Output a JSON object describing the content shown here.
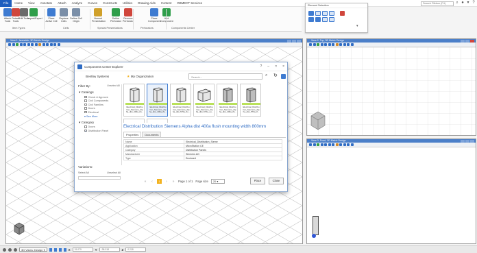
{
  "menu": {
    "file": "File",
    "items": [
      "Home",
      "View",
      "Annotate",
      "Attach",
      "Analyze",
      "Curves",
      "Constructs",
      "Utilities",
      "Drawing Aids",
      "Content",
      "OBMECT Services"
    ],
    "search_placeholder": "Search Ribbon (F4)"
  },
  "ribbon": {
    "buttons": [
      {
        "label": "Attach Tools",
        "color": "#3e7bd1"
      },
      {
        "label": "Detach Tools",
        "color": "#d0463c"
      },
      {
        "label": "Edit Tools",
        "color": "#6a6a6a"
      },
      {
        "label": "Import/Export",
        "color": "#2f9e4a"
      },
      {
        "label": "Place Active Cell",
        "color": "#3e7bd1"
      },
      {
        "label": "Replace Cells",
        "color": "#7b8fa8"
      },
      {
        "label": "Define Cell Origin",
        "color": "#7b8fa8"
      },
      {
        "label": "Normal Presentation",
        "color": "#d0a02a"
      },
      {
        "label": "Define Perforator",
        "color": "#2f9e4a"
      },
      {
        "label": "Remove Perforator",
        "color": "#d0463c"
      },
      {
        "label": "Place Component",
        "color": "#3e7bd1"
      },
      {
        "label": "Add Component",
        "color": "#2f9e4a"
      }
    ],
    "groups": [
      "Item Types",
      "Cells",
      "Special Presentations",
      "Perforators",
      "Components Center"
    ]
  },
  "element_selection": {
    "title": "Element Selection"
  },
  "views": {
    "view1_title": "View 1, Isometric, 3D Metric Design",
    "view2_title": "View 2, Top, 3D Metric Design",
    "view3_title": "View 3, Front, 3D Metric Design"
  },
  "dialog": {
    "title": "Components Center Explorer",
    "org": "Bentley Systems",
    "scope": "My Organization",
    "search_placeholder": "Search...",
    "filter_by": "Filter By:",
    "clear_all": "Unselect All",
    "catalogs_header": "Catalogs",
    "catalogs": [
      "Check & Approve",
      "Civil Components",
      "Civil Families",
      "Doors",
      "Electrical"
    ],
    "see_more": "See More",
    "category_header": "Category",
    "categories": [
      "Doors",
      "Distribution Panel"
    ],
    "variations_header": "Variations:",
    "select_all": "Select All",
    "unselect_all": "Unselect All",
    "thumbnails": [
      "Electrical_Distribu tion_Siemens_Alp ha_dist_400a_flu...",
      "Electrical_Distribu tion_Siemens_Alp ha_dist_400a_flu...",
      "Electrical_Distribu tion_Siemens_Alp ha_dist_570a_flu...",
      "Electrical_Distribu tion_Siemens_Alp ha_dist_570a_su...",
      "Electrical_Distribu tion_Siemens_Alp ha_dist_400a_flu...",
      "Electrical_Distribu tion_Siemens_Alp ha_dist_570a_fl..."
    ],
    "detail_title": "Electrical Distribution Siemens Alpha dist 400a flush mounting width 800mm",
    "tabs": [
      "Properties",
      "Documents"
    ],
    "properties": [
      [
        "Name",
        "Electrical_Distribution_Sieme"
      ],
      [
        "Application",
        "MicroStation CE"
      ],
      [
        "Category",
        "Distribution Panels"
      ],
      [
        "Manufacturer",
        "Siemens AG"
      ],
      [
        "Type",
        "Enclosed"
      ]
    ],
    "page": "1",
    "page_text": "Page 1 of 1",
    "page_size_label": "Page size",
    "page_size": "20",
    "place_label": "Place",
    "close_label": "Close"
  },
  "statusbar": {
    "view_select": "3D Views: Design",
    "x_label": "X",
    "x_value": "31.079",
    "y_label": "Y",
    "y_value": "-98.018",
    "z_label": "Z",
    "z_value": "0.218"
  }
}
